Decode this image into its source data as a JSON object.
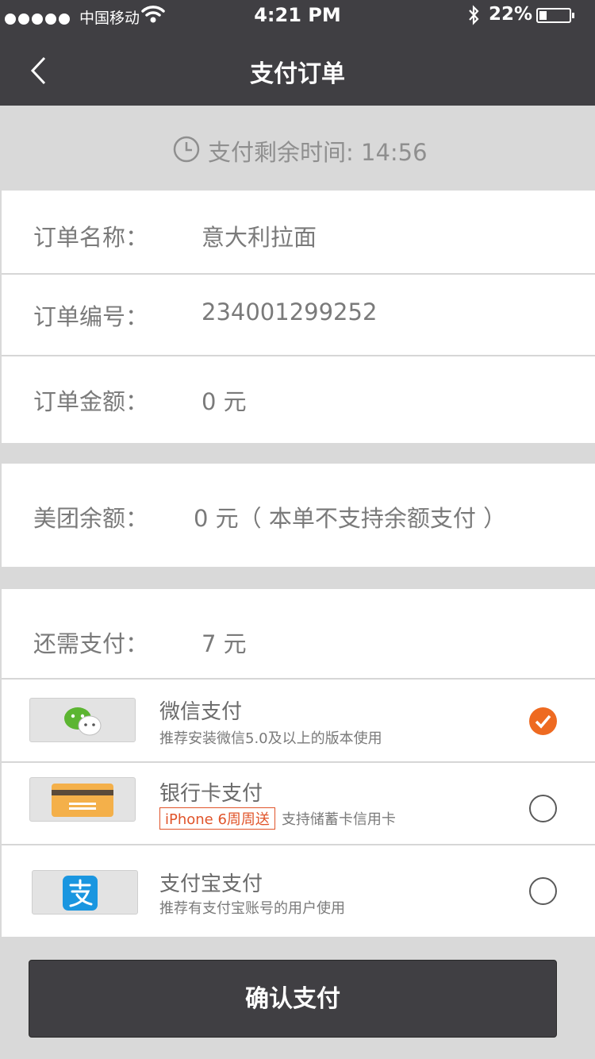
{
  "status_bar": {
    "carrier": "中国移动",
    "time": "4:21 PM",
    "battery": "22%"
  },
  "header": {
    "title": "支付订单"
  },
  "timer": {
    "label": "支付剩余时间: 14:56"
  },
  "order": {
    "name_label": "订单名称：",
    "name_value": "意大利拉面",
    "number_label": "订单编号：",
    "number_value": "234001299252",
    "amount_label": "订单金额：",
    "amount_value": "0 元"
  },
  "balance": {
    "label": "美团余额：",
    "value": "0 元（ 本单不支持余额支付 ）"
  },
  "remaining": {
    "label": "还需支付：",
    "value": "7 元"
  },
  "payment_methods": [
    {
      "name": "微信支付",
      "desc": "推荐安装微信5.0及以上的版本使用",
      "icon": "wechat-icon",
      "selected": true
    },
    {
      "name": "银行卡支付",
      "promo": "iPhone 6周周送",
      "desc": "支持储蓄卡信用卡",
      "icon": "bank-card-icon",
      "selected": false
    },
    {
      "name": "支付宝支付",
      "desc": "推荐有支付宝账号的用户使用",
      "icon": "alipay-icon",
      "selected": false
    }
  ],
  "confirm_label": "确认支付",
  "colors": {
    "header_bg": "#403f43",
    "accent": "#ee6a21",
    "promo": "#e0542a"
  }
}
